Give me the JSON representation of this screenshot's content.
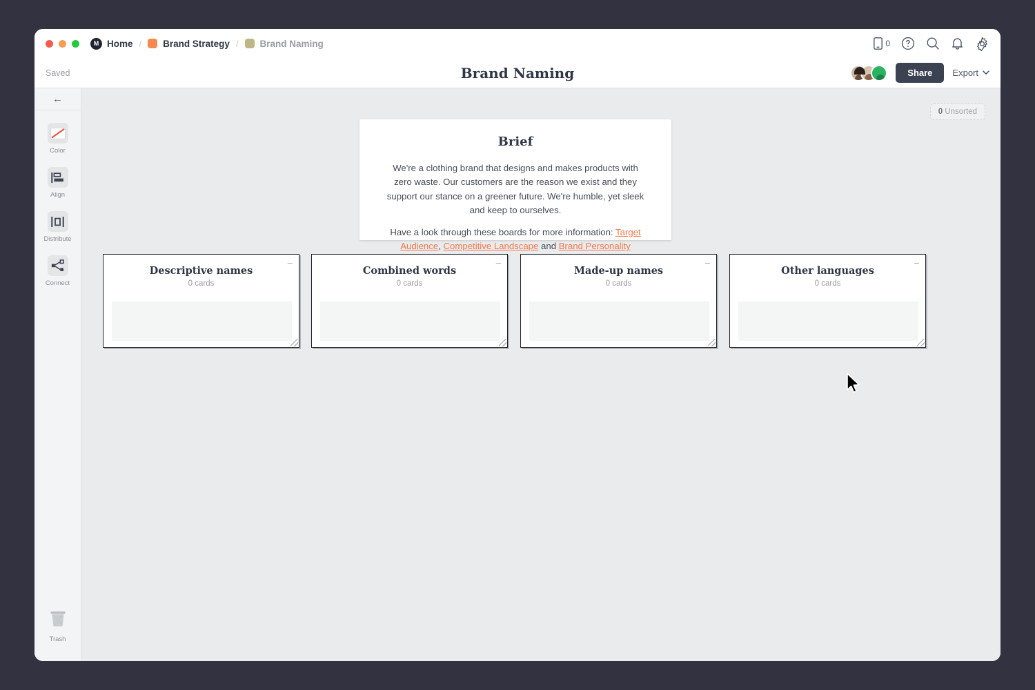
{
  "window": {
    "traffic_lights": [
      "close",
      "minimize",
      "maximize"
    ],
    "home_label": "Home",
    "home_logo_glyph": "M",
    "breadcrumb": [
      {
        "label": "Brand Strategy",
        "swatch": "#f58a50"
      },
      {
        "label": "Brand Naming",
        "swatch": "#bdb787"
      }
    ],
    "separator": "/"
  },
  "toolbar_icons": [
    {
      "name": "mobile-preview-icon",
      "count": "0"
    },
    {
      "name": "help-icon"
    },
    {
      "name": "search-icon"
    },
    {
      "name": "notifications-icon"
    },
    {
      "name": "settings-icon"
    }
  ],
  "header": {
    "save_status": "Saved",
    "title": "Brand Naming",
    "share_label": "Share",
    "export_label": "Export",
    "avatars": [
      "user-1",
      "user-2",
      "user-3"
    ]
  },
  "sidebar": {
    "back_glyph": "←",
    "tools": [
      {
        "label": "Color",
        "icon": "color-icon"
      },
      {
        "label": "Align",
        "icon": "align-icon"
      },
      {
        "label": "Distribute",
        "icon": "distribute-icon"
      },
      {
        "label": "Connect",
        "icon": "connect-icon"
      }
    ],
    "trash_label": "Trash"
  },
  "canvas": {
    "unsorted_count": "0",
    "unsorted_label": "Unsorted",
    "brief": {
      "title": "Brief",
      "paragraph1": "We're a clothing brand that designs and makes products with zero waste. Our customers are the reason we exist and they support our stance on a greener future. We're humble, yet sleek and keep to ourselves.",
      "paragraph2_prefix": "Have a look through these boards for more information: ",
      "link1": "Target Audience",
      "comma": ",",
      "link2": "Competitive Landscape",
      "conjunction": " and ",
      "link3": "Brand Personality",
      "link_color": "#f4784a"
    },
    "boards": [
      {
        "title": "Descriptive names",
        "cards": "0 cards",
        "minimize": "–"
      },
      {
        "title": "Combined words",
        "cards": "0 cards",
        "minimize": "–"
      },
      {
        "title": "Made-up names",
        "cards": "0 cards",
        "minimize": "–"
      },
      {
        "title": "Other languages",
        "cards": "0 cards",
        "minimize": "–"
      }
    ]
  },
  "colors": {
    "desktop_bg": "#323240",
    "canvas_bg": "#eaebec",
    "accent_orange": "#f4784a",
    "share_bg": "#3b4252",
    "title_navy": "#2f3646"
  }
}
